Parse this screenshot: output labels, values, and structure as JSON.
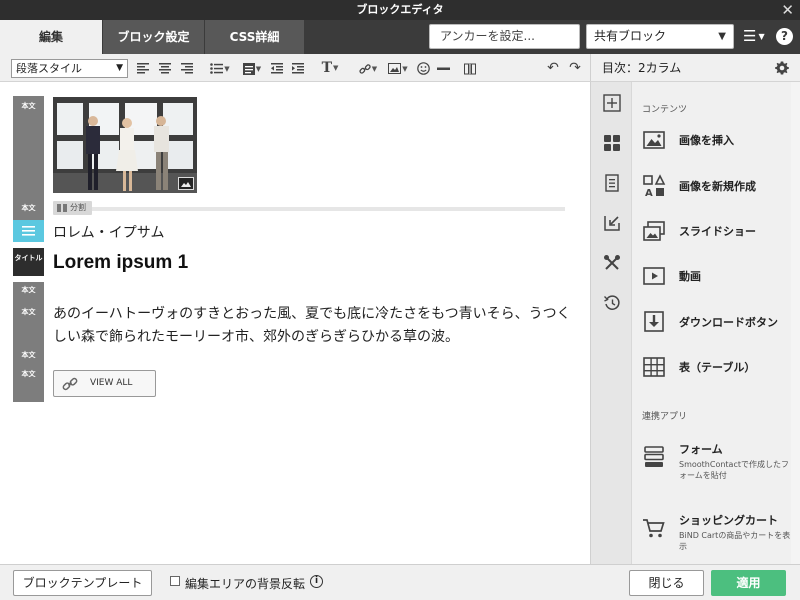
{
  "window": {
    "title": "ブロックエディタ",
    "close_glyph": "✕"
  },
  "tabs": [
    {
      "label": "編集",
      "active": true
    },
    {
      "label": "ブロック設定",
      "active": false
    },
    {
      "label": "CSS詳細",
      "active": false
    }
  ],
  "header": {
    "anchor_placeholder": "アンカーを設定...",
    "shared_block": "共有ブロック",
    "help_glyph": "?"
  },
  "toolbar": {
    "paragraph_style": "段落スタイル",
    "text_icon": "T"
  },
  "panel": {
    "title": "目次：2カラム",
    "sections": {
      "contents": "コンテンツ",
      "linked_apps": "連携アプリ"
    },
    "items": [
      {
        "label": "画像を挿入",
        "icon": "image-icon"
      },
      {
        "label": "画像を新規作成",
        "icon": "shapes-icon"
      },
      {
        "label": "スライドショー",
        "icon": "slideshow-icon"
      },
      {
        "label": "動画",
        "icon": "video-icon"
      },
      {
        "label": "ダウンロードボタン",
        "icon": "download-icon"
      },
      {
        "label": "表（テーブル）",
        "icon": "table-icon"
      }
    ],
    "apps": [
      {
        "label": "フォーム",
        "sub": "SmoothContactで作成したフォームを貼付",
        "icon": "form-icon"
      },
      {
        "label": "ショッピングカート",
        "sub": "BiND Cartの商品やカートを表示",
        "icon": "cart-icon"
      }
    ]
  },
  "editor": {
    "strip_labels": {
      "body": "本文",
      "title": "タイトル"
    },
    "divider_label": "分割",
    "heading_jp": "ロレム・イプサム",
    "title_en": "Lorem ipsum 1",
    "body_text": "あのイーハトーヴォのすきとおった風、夏でも底に冷たさをもつ青いそら、うつくしい森で飾られたモーリーオ市、郊外のぎらぎらひかる草の波。",
    "view_all": "VIEW ALL"
  },
  "footer": {
    "template_button": "ブロックテンプレート",
    "bg_toggle_label": "編集エリアの背景反転",
    "info_glyph": "i",
    "close_button": "閉じる",
    "apply_button": "適用"
  },
  "colors": {
    "accent_green": "#4cbf7f",
    "strip_blue": "#5bc8e0",
    "strip_gray": "#7d7d7d",
    "dark_bar": "#2e2e2e"
  }
}
